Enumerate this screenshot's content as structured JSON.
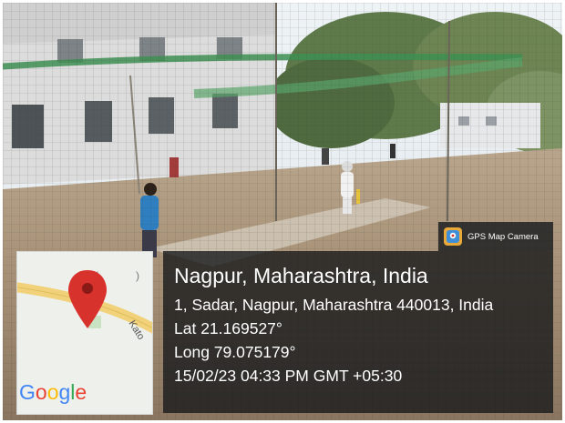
{
  "badge": {
    "label": "GPS Map Camera",
    "icon": "gps-map-camera-app-icon"
  },
  "location": {
    "city": "Nagpur, Maharashtra, India",
    "address": "1, Sadar, Nagpur, Maharashtra 440013, India",
    "lat": "Lat 21.169527°",
    "long": "Long 79.075179°",
    "datetime": "15/02/23 04:33 PM GMT +05:30"
  },
  "map": {
    "logo": "Google",
    "road_label": "Kato",
    "pin_icon": "map-pin-icon"
  },
  "colors": {
    "pin": "#d8322c",
    "road": "#f1d27a",
    "panel": "#141719"
  }
}
